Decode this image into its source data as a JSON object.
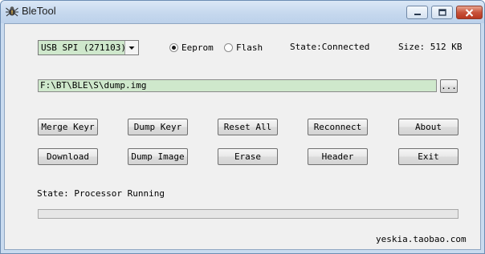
{
  "window": {
    "title": "BleTool"
  },
  "device_select": {
    "value": "USB SPI (271103)"
  },
  "memory": {
    "eeprom_label": "Eeprom",
    "flash_label": "Flash",
    "selected": "Eeprom"
  },
  "status": {
    "state_header": "State:Connected",
    "size": "Size: 512 KB",
    "state_line": "State:  Processor Running",
    "progress": 0
  },
  "file": {
    "path": "F:\\BT\\BLE\\S\\dump.img",
    "browse_label": "..."
  },
  "buttons_row1": [
    "Merge Keyr",
    "Dump Keyr",
    "Reset All",
    "Reconnect",
    "About"
  ],
  "buttons_row2": [
    "Download",
    "Dump Image",
    "Erase",
    "Header",
    "Exit"
  ],
  "footer": {
    "text": "yeskia.taobao.com"
  }
}
